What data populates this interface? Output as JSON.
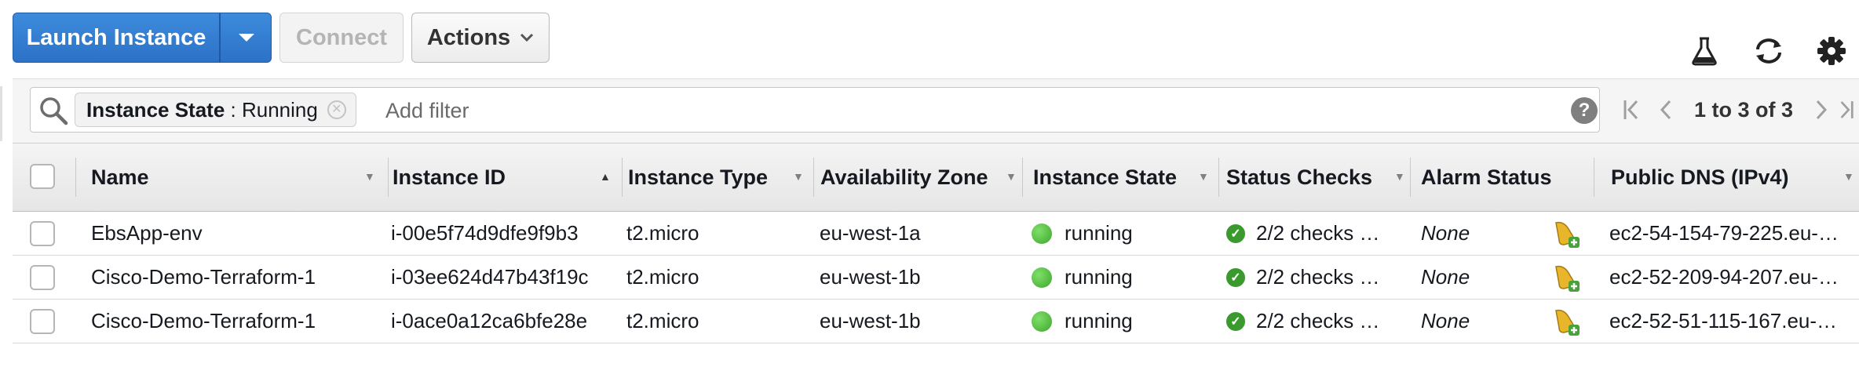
{
  "toolbar": {
    "launch_label": "Launch Instance",
    "connect_label": "Connect",
    "actions_label": "Actions",
    "icons": [
      "flask-icon",
      "refresh-icon",
      "gear-icon"
    ]
  },
  "filter": {
    "chip_key": "Instance State",
    "chip_separator": " : ",
    "chip_value": "Running",
    "placeholder": "Add filter",
    "help": "?"
  },
  "pagination": {
    "text": "1 to 3 of 3"
  },
  "table": {
    "columns": [
      {
        "label": "Name",
        "sort": "none"
      },
      {
        "label": "Instance ID",
        "sort": "ascending"
      },
      {
        "label": "Instance Type",
        "sort": "none"
      },
      {
        "label": "Availability Zone",
        "sort": "none"
      },
      {
        "label": "Instance State",
        "sort": "none"
      },
      {
        "label": "Status Checks",
        "sort": "none"
      },
      {
        "label": "Alarm Status",
        "sort": "none"
      },
      {
        "label": "Public DNS (IPv4)",
        "sort": "none"
      }
    ],
    "rows": [
      {
        "name": "EbsApp-env",
        "instance_id": "i-00e5f74d9dfe9f9b3",
        "type": "t2.micro",
        "zone": "eu-west-1a",
        "state": "running",
        "checks": "2/2 checks …",
        "alarm": "None",
        "dns": "ec2-54-154-79-225.eu-…"
      },
      {
        "name": "Cisco-Demo-Terraform-1",
        "instance_id": "i-03ee624d47b43f19c",
        "type": "t2.micro",
        "zone": "eu-west-1b",
        "state": "running",
        "checks": "2/2 checks …",
        "alarm": "None",
        "dns": "ec2-52-209-94-207.eu-…"
      },
      {
        "name": "Cisco-Demo-Terraform-1",
        "instance_id": "i-0ace0a12ca6bfe28e",
        "type": "t2.micro",
        "zone": "eu-west-1b",
        "state": "running",
        "checks": "2/2 checks …",
        "alarm": "None",
        "dns": "ec2-52-51-115-167.eu-…"
      }
    ]
  },
  "colors": {
    "primary_button": "#2c72c7",
    "running_green": "#3ea52d"
  }
}
